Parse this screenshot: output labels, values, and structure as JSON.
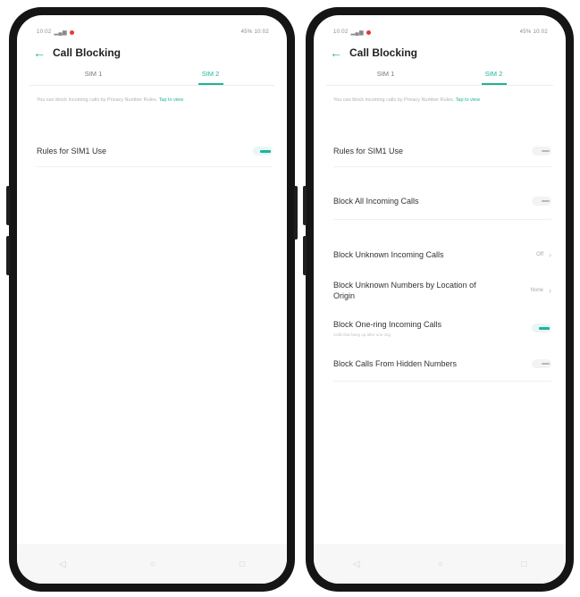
{
  "left": {
    "status_time": "10:02",
    "status_right": "45% 10:02",
    "title": "Call Blocking",
    "tabs": [
      "SIM 1",
      "SIM 2"
    ],
    "description": "You can block incoming calls by Privacy Number Rules.",
    "description_link": "Tap to view",
    "rows": [
      {
        "label": "Rules for SIM1 Use",
        "toggle": "on"
      }
    ]
  },
  "right": {
    "status_time": "10:02",
    "status_right": "45% 10:02",
    "title": "Call Blocking",
    "tabs": [
      "SIM 1",
      "SIM 2"
    ],
    "description": "You can block incoming calls by Privacy Number Rules.",
    "description_link": "Tap to view",
    "rows": [
      {
        "label": "Rules for SIM1 Use",
        "toggle": "off"
      },
      {
        "label": "Block All Incoming Calls",
        "toggle": "off"
      },
      {
        "label": "Block Unknown Incoming Calls",
        "value": "Off"
      },
      {
        "label": "Block Unknown Numbers by Location of Origin",
        "value": "None"
      },
      {
        "label": "Block One-ring Incoming Calls",
        "sub": "Calls that hang up after one ring",
        "toggle": "on"
      },
      {
        "label": "Block Calls From Hidden Numbers",
        "toggle": "off"
      }
    ]
  },
  "nav": {
    "back": "◁",
    "home": "○",
    "recent": "□"
  },
  "colors": {
    "accent": "#1fb39a",
    "frame": "#151515"
  },
  "icons": {
    "back": "back-arrow-icon",
    "chevron": "chevron-right-icon"
  }
}
